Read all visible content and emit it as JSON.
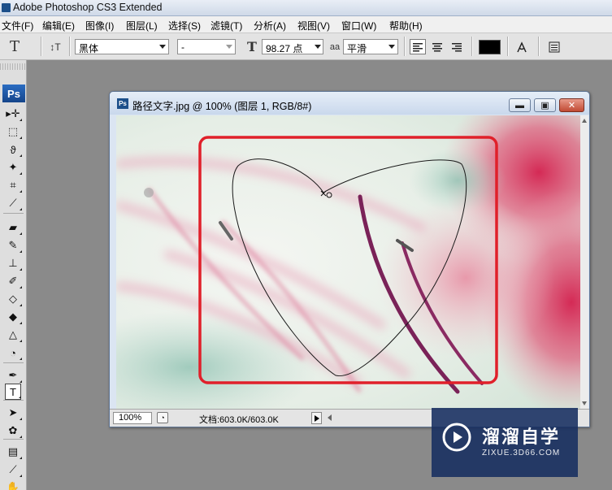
{
  "app": {
    "title": "Adobe Photoshop CS3 Extended"
  },
  "menu": [
    "文件(F)",
    "编辑(E)",
    "图像(I)",
    "图层(L)",
    "选择(S)",
    "滤镜(T)",
    "分析(A)",
    "视图(V)",
    "窗口(W)",
    "帮助(H)"
  ],
  "options": {
    "tool_glyph": "T",
    "orient_glyph": "↕T",
    "font_family": "黑体",
    "font_style": "-",
    "size_glyph": "T",
    "font_size": "98.27 点",
    "aa_glyph": "aa",
    "antialias": "平滑",
    "text_color": "#000000",
    "align": [
      "left",
      "center",
      "right"
    ],
    "align_selected": "left"
  },
  "toolbox": {
    "logo": "Ps",
    "tools": [
      {
        "name": "move-tool-icon",
        "glyph": "▸✛"
      },
      {
        "name": "marquee-tool-icon",
        "glyph": "⬚"
      },
      {
        "name": "lasso-tool-icon",
        "glyph": "ϑ"
      },
      {
        "name": "magic-wand-tool-icon",
        "glyph": "✦"
      },
      {
        "name": "crop-tool-icon",
        "glyph": "⌗"
      },
      {
        "name": "eyedropper-tool-icon",
        "glyph": "⟋"
      },
      {
        "name": "healing-brush-tool-icon",
        "glyph": "▰"
      },
      {
        "name": "brush-tool-icon",
        "glyph": "✎"
      },
      {
        "name": "clone-stamp-tool-icon",
        "glyph": "⊥"
      },
      {
        "name": "history-brush-tool-icon",
        "glyph": "✐"
      },
      {
        "name": "eraser-tool-icon",
        "glyph": "◇"
      },
      {
        "name": "paint-bucket-tool-icon",
        "glyph": "◆"
      },
      {
        "name": "blur-tool-icon",
        "glyph": "△"
      },
      {
        "name": "dodge-tool-icon",
        "glyph": "◔"
      },
      {
        "name": "pen-tool-icon",
        "glyph": "✒"
      },
      {
        "name": "type-tool-icon",
        "glyph": "T"
      },
      {
        "name": "path-selection-tool-icon",
        "glyph": "➤"
      },
      {
        "name": "custom-shape-tool-icon",
        "glyph": "✿"
      },
      {
        "name": "notes-tool-icon",
        "glyph": "▤"
      },
      {
        "name": "eyedropper2-tool-icon",
        "glyph": "⟋"
      },
      {
        "name": "hand-tool-icon",
        "glyph": "✋"
      }
    ],
    "selected": "type-tool-icon"
  },
  "document": {
    "title": "路径文字.jpg @ 100% (图层 1, RGB/8#)",
    "icon": "Ps",
    "zoom": "100%",
    "info": "文档:603.0K/603.0K"
  },
  "colors": {
    "highlight_frame": "#e0202a",
    "path_stroke": "#1a1a1a"
  },
  "watermark": {
    "brand": "溜溜自学",
    "site": "ZIXUE.3D66.COM"
  }
}
